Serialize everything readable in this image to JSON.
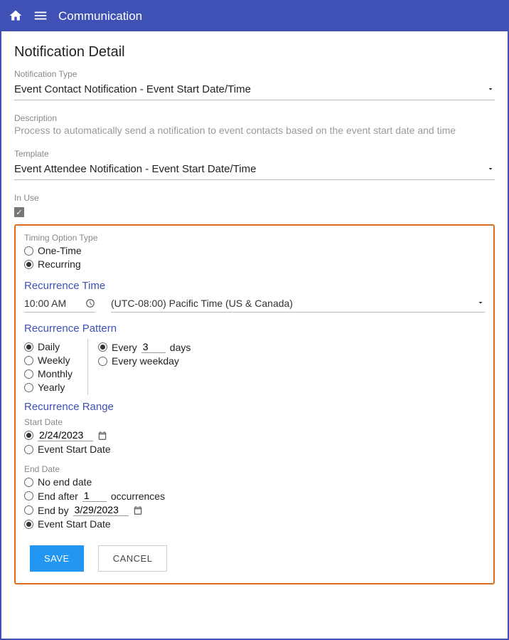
{
  "header": {
    "title": "Communication"
  },
  "detail": {
    "title": "Notification Detail",
    "notificationType": {
      "label": "Notification Type",
      "value": "Event Contact Notification - Event Start Date/Time"
    },
    "description": {
      "label": "Description",
      "value": "Process to automatically send a notification to event contacts based on the event start date and time"
    },
    "template": {
      "label": "Template",
      "value": "Event Attendee Notification - Event Start Date/Time"
    },
    "inUse": {
      "label": "In Use",
      "checked": true
    }
  },
  "timing": {
    "label": "Timing Option Type",
    "options": {
      "oneTime": "One-Time",
      "recurring": "Recurring"
    },
    "selected": "recurring"
  },
  "recurrenceTime": {
    "header": "Recurrence Time",
    "time": "10:00 AM",
    "timezone": "(UTC-08:00) Pacific Time (US & Canada)"
  },
  "pattern": {
    "header": "Recurrence Pattern",
    "freq": {
      "daily": "Daily",
      "weekly": "Weekly",
      "monthly": "Monthly",
      "yearly": "Yearly",
      "selected": "daily"
    },
    "daily": {
      "everyPrefix": "Every",
      "everyValue": "3",
      "everySuffix": "days",
      "everyWeekday": "Every weekday",
      "selected": "everyN"
    }
  },
  "range": {
    "header": "Recurrence Range",
    "start": {
      "label": "Start Date",
      "specificDate": "2/24/2023",
      "eventStart": "Event Start Date",
      "selected": "specific"
    },
    "end": {
      "label": "End Date",
      "noEnd": "No end date",
      "endAfterPrefix": "End after",
      "endAfterValue": "1",
      "endAfterSuffix": "occurrences",
      "endByPrefix": "End by",
      "endByDate": "3/29/2023",
      "eventStart": "Event Start Date",
      "selected": "eventStart"
    }
  },
  "buttons": {
    "save": "SAVE",
    "cancel": "CANCEL"
  }
}
